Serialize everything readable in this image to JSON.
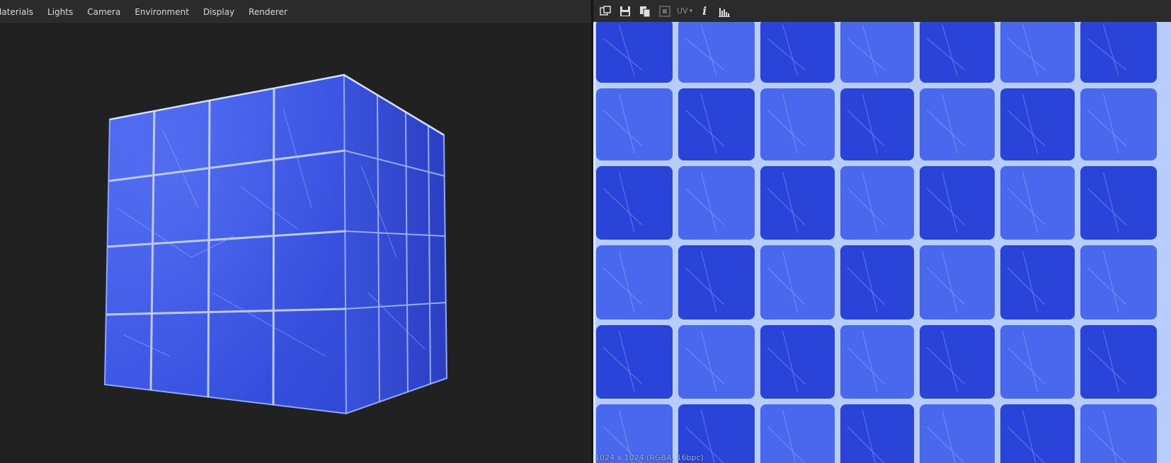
{
  "menubar": {
    "items": [
      "Materials",
      "Lights",
      "Camera",
      "Environment",
      "Display",
      "Renderer"
    ]
  },
  "toolbar": {
    "uv_label": "UV",
    "icons": [
      "view-toggle-icon",
      "save-icon",
      "copy-icon",
      "channel-icon",
      "uv-dropdown",
      "info-icon",
      "histogram-icon"
    ]
  },
  "texture": {
    "status": "1024 x 1024 (RGBA, 16bpc)"
  },
  "colors": {
    "tile": "#2a43d8",
    "tile_light": "#4a68ee",
    "grout": "#b7ccff",
    "bg": "#212121"
  }
}
